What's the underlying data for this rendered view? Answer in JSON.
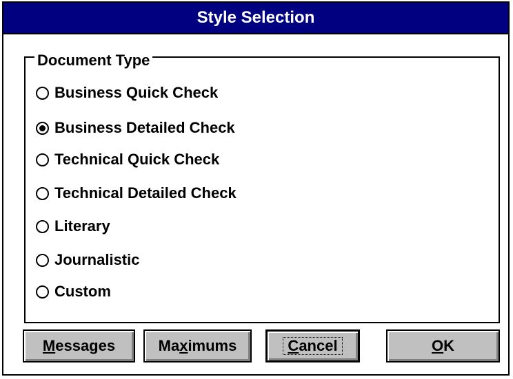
{
  "dialog": {
    "title": "Style Selection"
  },
  "group": {
    "label": "Document Type",
    "options": [
      {
        "label": "Business Quick Check",
        "selected": false
      },
      {
        "label": "Business Detailed Check",
        "selected": true
      },
      {
        "label": "Technical Quick Check",
        "selected": false
      },
      {
        "label": "Technical Detailed Check",
        "selected": false
      },
      {
        "label": "Literary",
        "selected": false
      },
      {
        "label": "Journalistic",
        "selected": false
      },
      {
        "label": "Custom",
        "selected": false
      }
    ]
  },
  "buttons": {
    "messages": {
      "mnemonic": "M",
      "rest": "essages"
    },
    "maximums": {
      "pre": "Ma",
      "mnemonic": "x",
      "rest": "imums"
    },
    "cancel": {
      "mnemonic": "C",
      "rest": "ancel"
    },
    "ok": {
      "mnemonic": "O",
      "rest": "K"
    }
  },
  "colors": {
    "titlebar": "#000080",
    "button_face": "#c0c0c0"
  }
}
